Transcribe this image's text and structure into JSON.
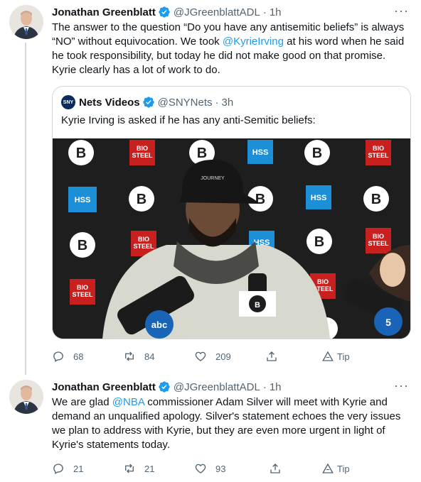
{
  "tweets": [
    {
      "author_name": "Jonathan Greenblatt",
      "handle": "@JGreenblattADL",
      "separator": "·",
      "time": "1h",
      "text_parts": {
        "p1": "The answer to the question “Do you have any antisemitic beliefs” is always “NO” without equivocation. We took ",
        "mention": "@KyrieIrving",
        "p2": " at his word when he said he took responsibility, but today he did not make good on that promise. Kyrie clearly has a lot of work to do."
      },
      "quote": {
        "avatar_text": "SNY",
        "author_name": "Nets Videos",
        "handle": "@SNYNets",
        "separator": "·",
        "time": "3h",
        "text": "Kyrie Irving is asked if he has any anti-Semitic beliefs:",
        "media": {
          "backdrop_brands": [
            "BIO STEEL",
            "HSS"
          ],
          "mic_flags": [
            "abc",
            "5"
          ]
        }
      },
      "actions": {
        "replies": "68",
        "retweets": "84",
        "likes": "209",
        "tip": "Tip"
      }
    },
    {
      "author_name": "Jonathan Greenblatt",
      "handle": "@JGreenblattADL",
      "separator": "·",
      "time": "1h",
      "text_parts": {
        "p1": "We are glad ",
        "mention": "@NBA",
        "p2": " commissioner Adam Silver will meet with Kyrie and demand an unqualified apology. Silver's statement echoes the very issues we plan to address with Kyrie, but they are even more urgent in light of Kyrie's statements today."
      },
      "actions": {
        "replies": "21",
        "retweets": "21",
        "likes": "93",
        "tip": "Tip"
      }
    }
  ],
  "colors": {
    "text": "#0f1419",
    "secondary": "#536471",
    "link": "#1d9bf0",
    "border": "#cfd9de",
    "verified": "#1d9bf0"
  },
  "icons": {
    "more": "more-dots-icon",
    "verified": "verified-badge-icon",
    "reply": "reply-icon",
    "retweet": "retweet-icon",
    "like": "heart-icon",
    "share": "share-icon",
    "tip": "tip-icon"
  }
}
